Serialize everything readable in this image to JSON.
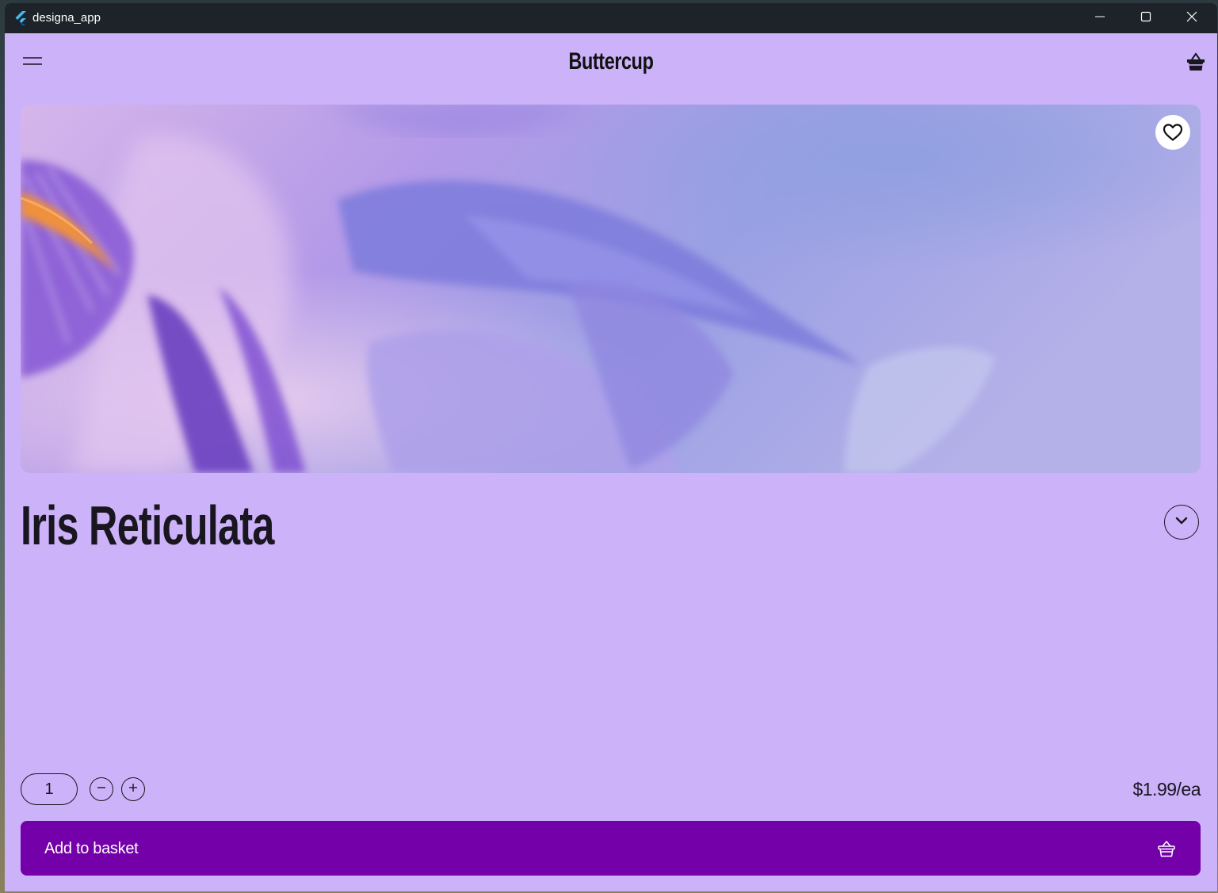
{
  "window": {
    "title": "designa_app",
    "icon": "flutter-logo-icon",
    "controls": [
      "minimize-icon",
      "maximize-icon",
      "close-icon"
    ]
  },
  "appbar": {
    "menu_icon": "hamburger-menu-icon",
    "brand": "Buttercup",
    "basket_icon": "basket-icon"
  },
  "product": {
    "image_alt": "purple iris flower close-up",
    "favorite_icon": "heart-outline-icon",
    "name": "Iris Reticulata",
    "expand_icon": "chevron-down-icon",
    "quantity": "1",
    "price": "$1.99/ea"
  },
  "actions": {
    "decrement_icon": "minus-icon",
    "increment_icon": "plus-icon",
    "add_to_basket_label": "Add to basket",
    "add_to_basket_icon": "basket-icon"
  },
  "colors": {
    "background": "#ccb2f9",
    "titlebar": "#1d2328",
    "primary_button": "#7300a8",
    "text": "#1a1620"
  }
}
